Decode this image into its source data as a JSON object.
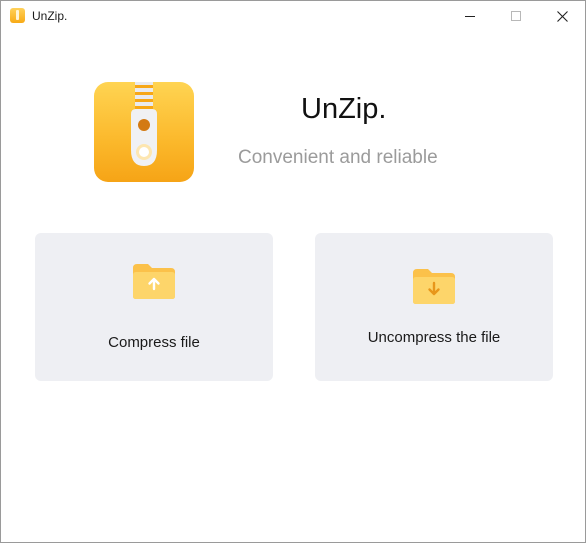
{
  "window": {
    "title": "UnZip.",
    "controls": [
      "minimize-icon",
      "maximize-icon",
      "close-icon"
    ]
  },
  "header": {
    "app_name": "UnZip.",
    "tagline": "Convenient and reliable"
  },
  "actions": {
    "compress_label": "Compress file",
    "uncompress_label": "Uncompress the file"
  },
  "colors": {
    "accent_top": "#ffd452",
    "accent_bottom": "#f6a416",
    "card_bg": "#eeeff3",
    "tagline": "#9b9b9b"
  }
}
